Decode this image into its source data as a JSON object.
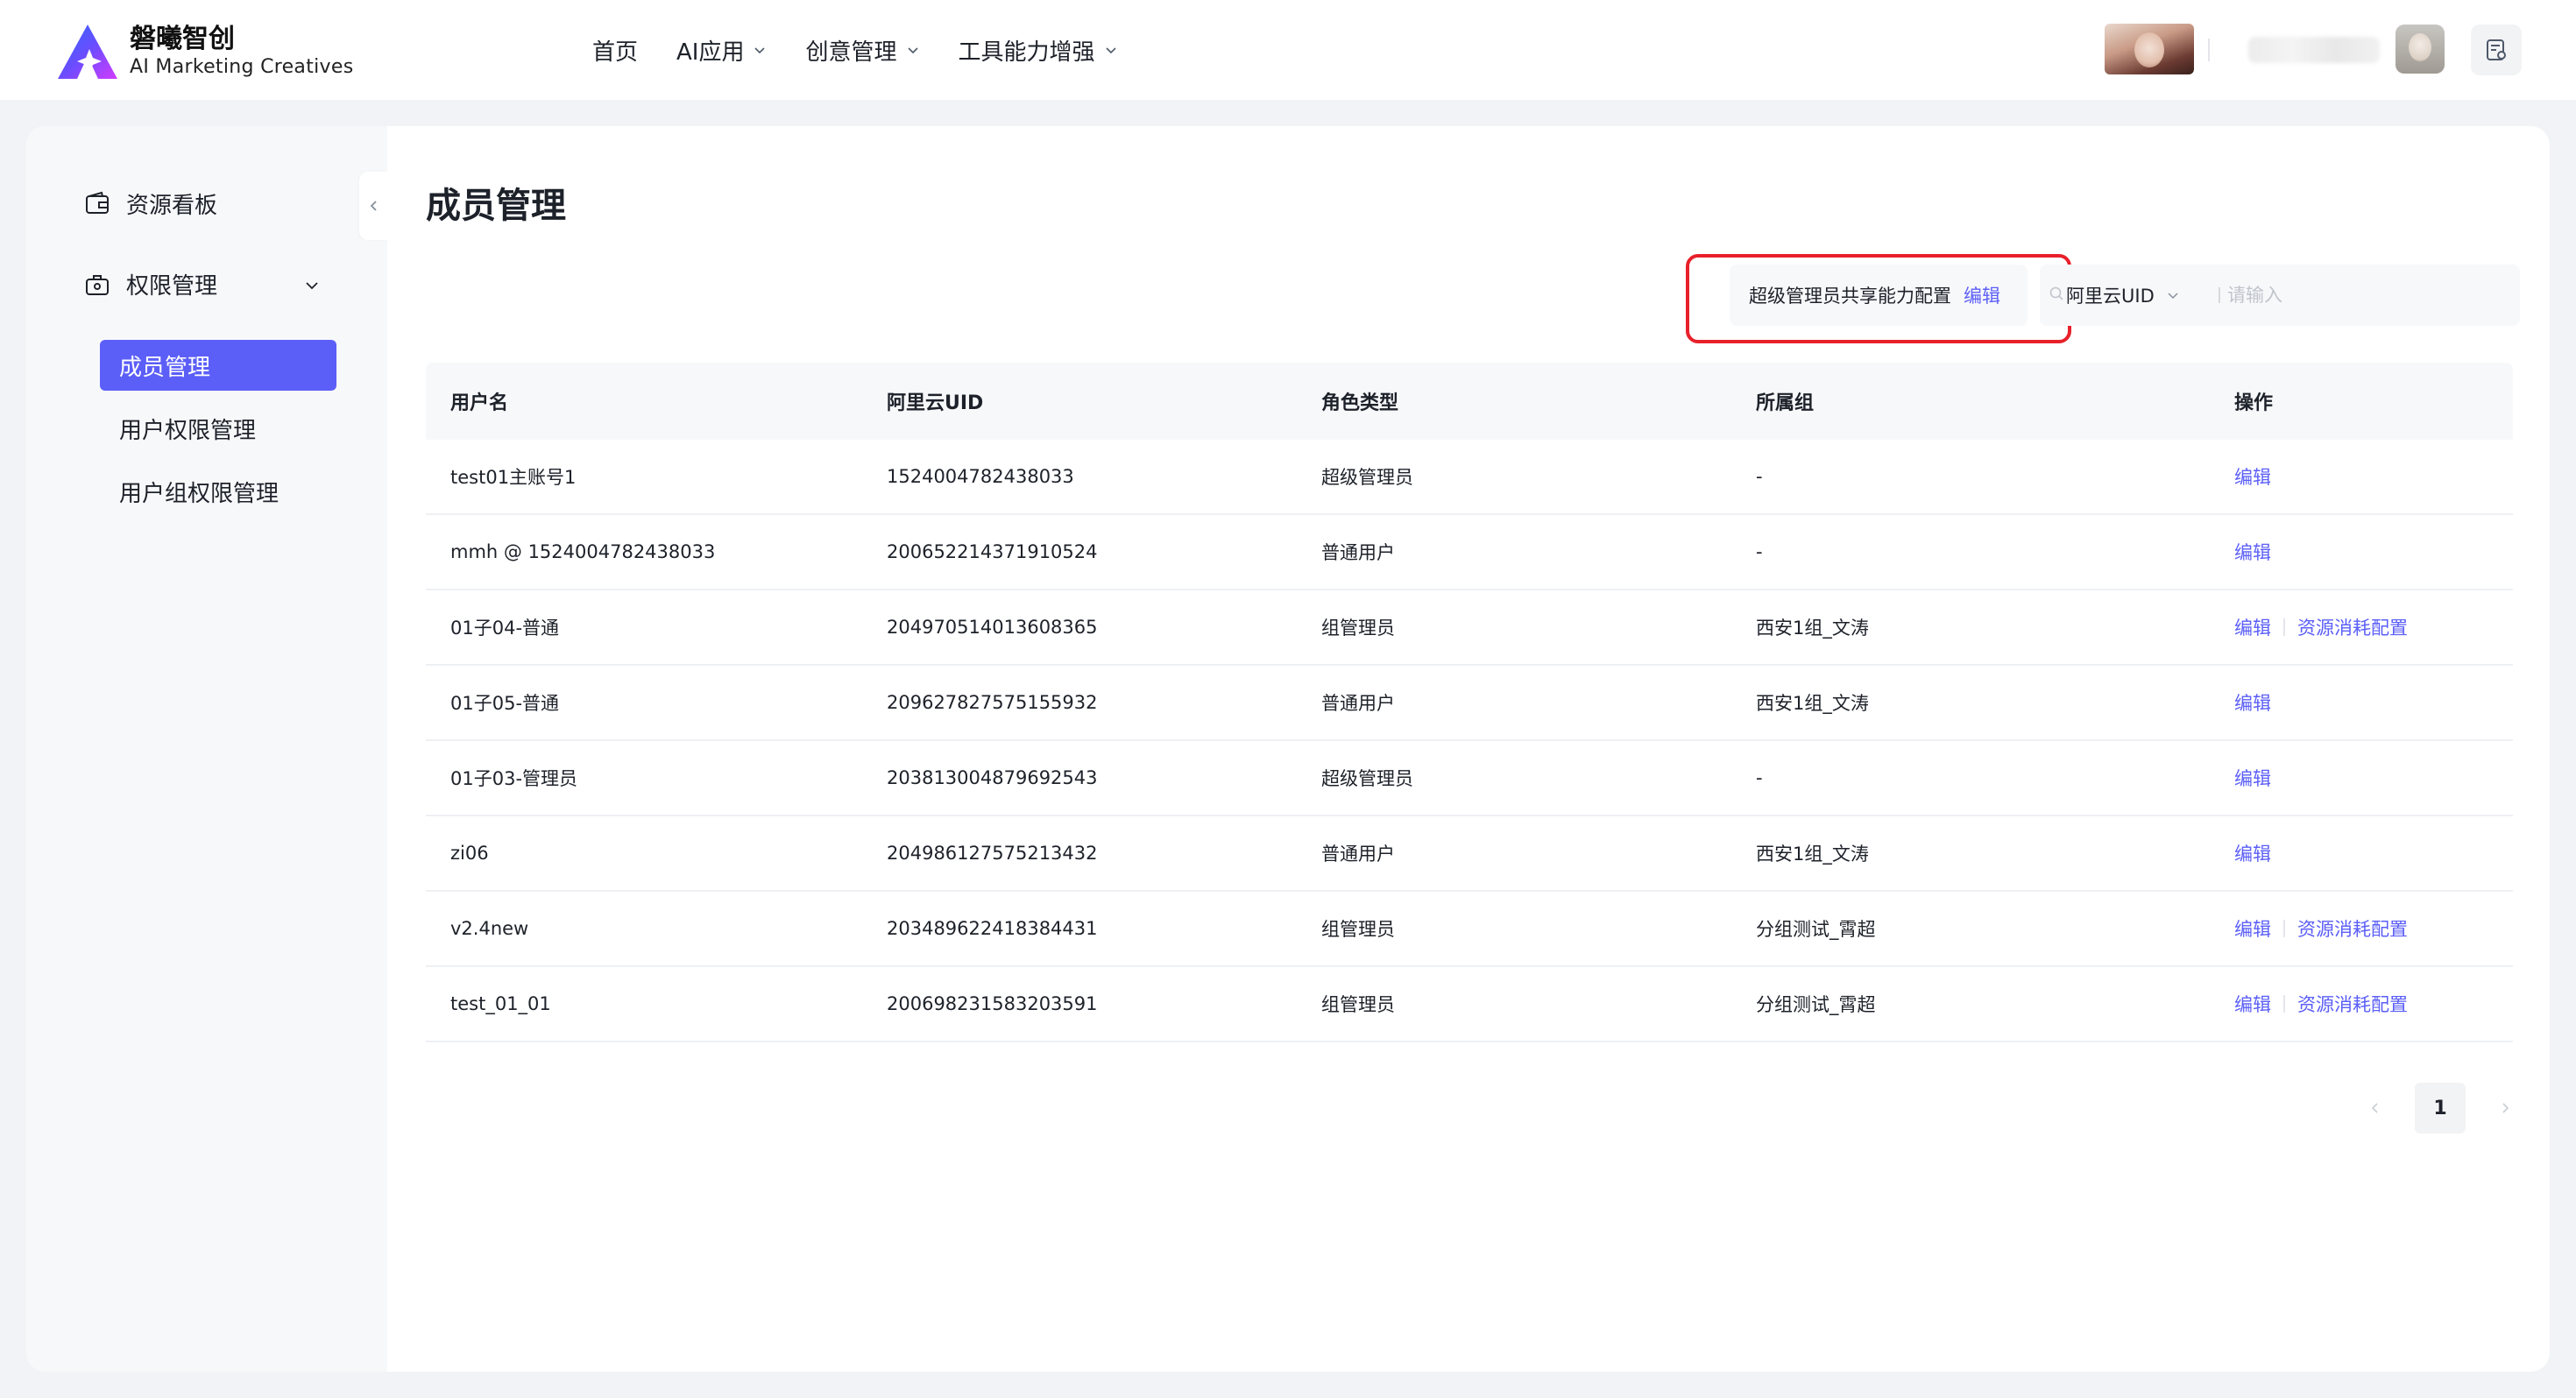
{
  "brand": {
    "name_cn": "磐曦智创",
    "name_en": "AI Marketing Creatives"
  },
  "nav": [
    {
      "label": "首页",
      "has_dropdown": false
    },
    {
      "label": "AI应用",
      "has_dropdown": true
    },
    {
      "label": "创意管理",
      "has_dropdown": true
    },
    {
      "label": "工具能力增强",
      "has_dropdown": true
    }
  ],
  "sidebar": {
    "items": [
      {
        "label": "资源看板",
        "icon": "wallet-icon"
      },
      {
        "label": "权限管理",
        "icon": "briefcase-lock-icon",
        "expanded": true
      }
    ],
    "sub_items": [
      {
        "label": "成员管理",
        "active": true
      },
      {
        "label": "用户权限管理",
        "active": false
      },
      {
        "label": "用户组权限管理",
        "active": false
      }
    ]
  },
  "page": {
    "title": "成员管理"
  },
  "toolbar": {
    "config_label": "超级管理员共享能力配置",
    "config_edit": "编辑",
    "search_select": "阿里云UID",
    "search_placeholder": "请输入"
  },
  "table": {
    "headers": [
      "用户名",
      "阿里云UID",
      "角色类型",
      "所属组",
      "操作"
    ],
    "rows": [
      {
        "user": "test01主账号1",
        "uid": "1524004782438033",
        "role": "超级管理员",
        "group": "-",
        "actions": [
          "编辑"
        ]
      },
      {
        "user": "mmh @ 1524004782438033",
        "uid": "200652214371910524",
        "role": "普通用户",
        "group": "-",
        "actions": [
          "编辑"
        ]
      },
      {
        "user": "01子04-普通",
        "uid": "204970514013608365",
        "role": "组管理员",
        "group": "西安1组_文涛",
        "actions": [
          "编辑",
          "资源消耗配置"
        ]
      },
      {
        "user": "01子05-普通",
        "uid": "209627827575155932",
        "role": "普通用户",
        "group": "西安1组_文涛",
        "actions": [
          "编辑"
        ]
      },
      {
        "user": "01子03-管理员",
        "uid": "203813004879692543",
        "role": "超级管理员",
        "group": "-",
        "actions": [
          "编辑"
        ]
      },
      {
        "user": "zi06",
        "uid": "204986127575213432",
        "role": "普通用户",
        "group": "西安1组_文涛",
        "actions": [
          "编辑"
        ]
      },
      {
        "user": "v2.4new",
        "uid": "203489622418384431",
        "role": "组管理员",
        "group": "分组测试_霄超",
        "actions": [
          "编辑",
          "资源消耗配置"
        ]
      },
      {
        "user": "test_01_01",
        "uid": "200698231583203591",
        "role": "组管理员",
        "group": "分组测试_霄超",
        "actions": [
          "编辑",
          "资源消耗配置"
        ]
      }
    ]
  },
  "pagination": {
    "current": "1"
  },
  "colors": {
    "accent": "#5b5ef7",
    "highlight_box": "#e8202a",
    "sidebar_bg": "#f7f8fa"
  }
}
